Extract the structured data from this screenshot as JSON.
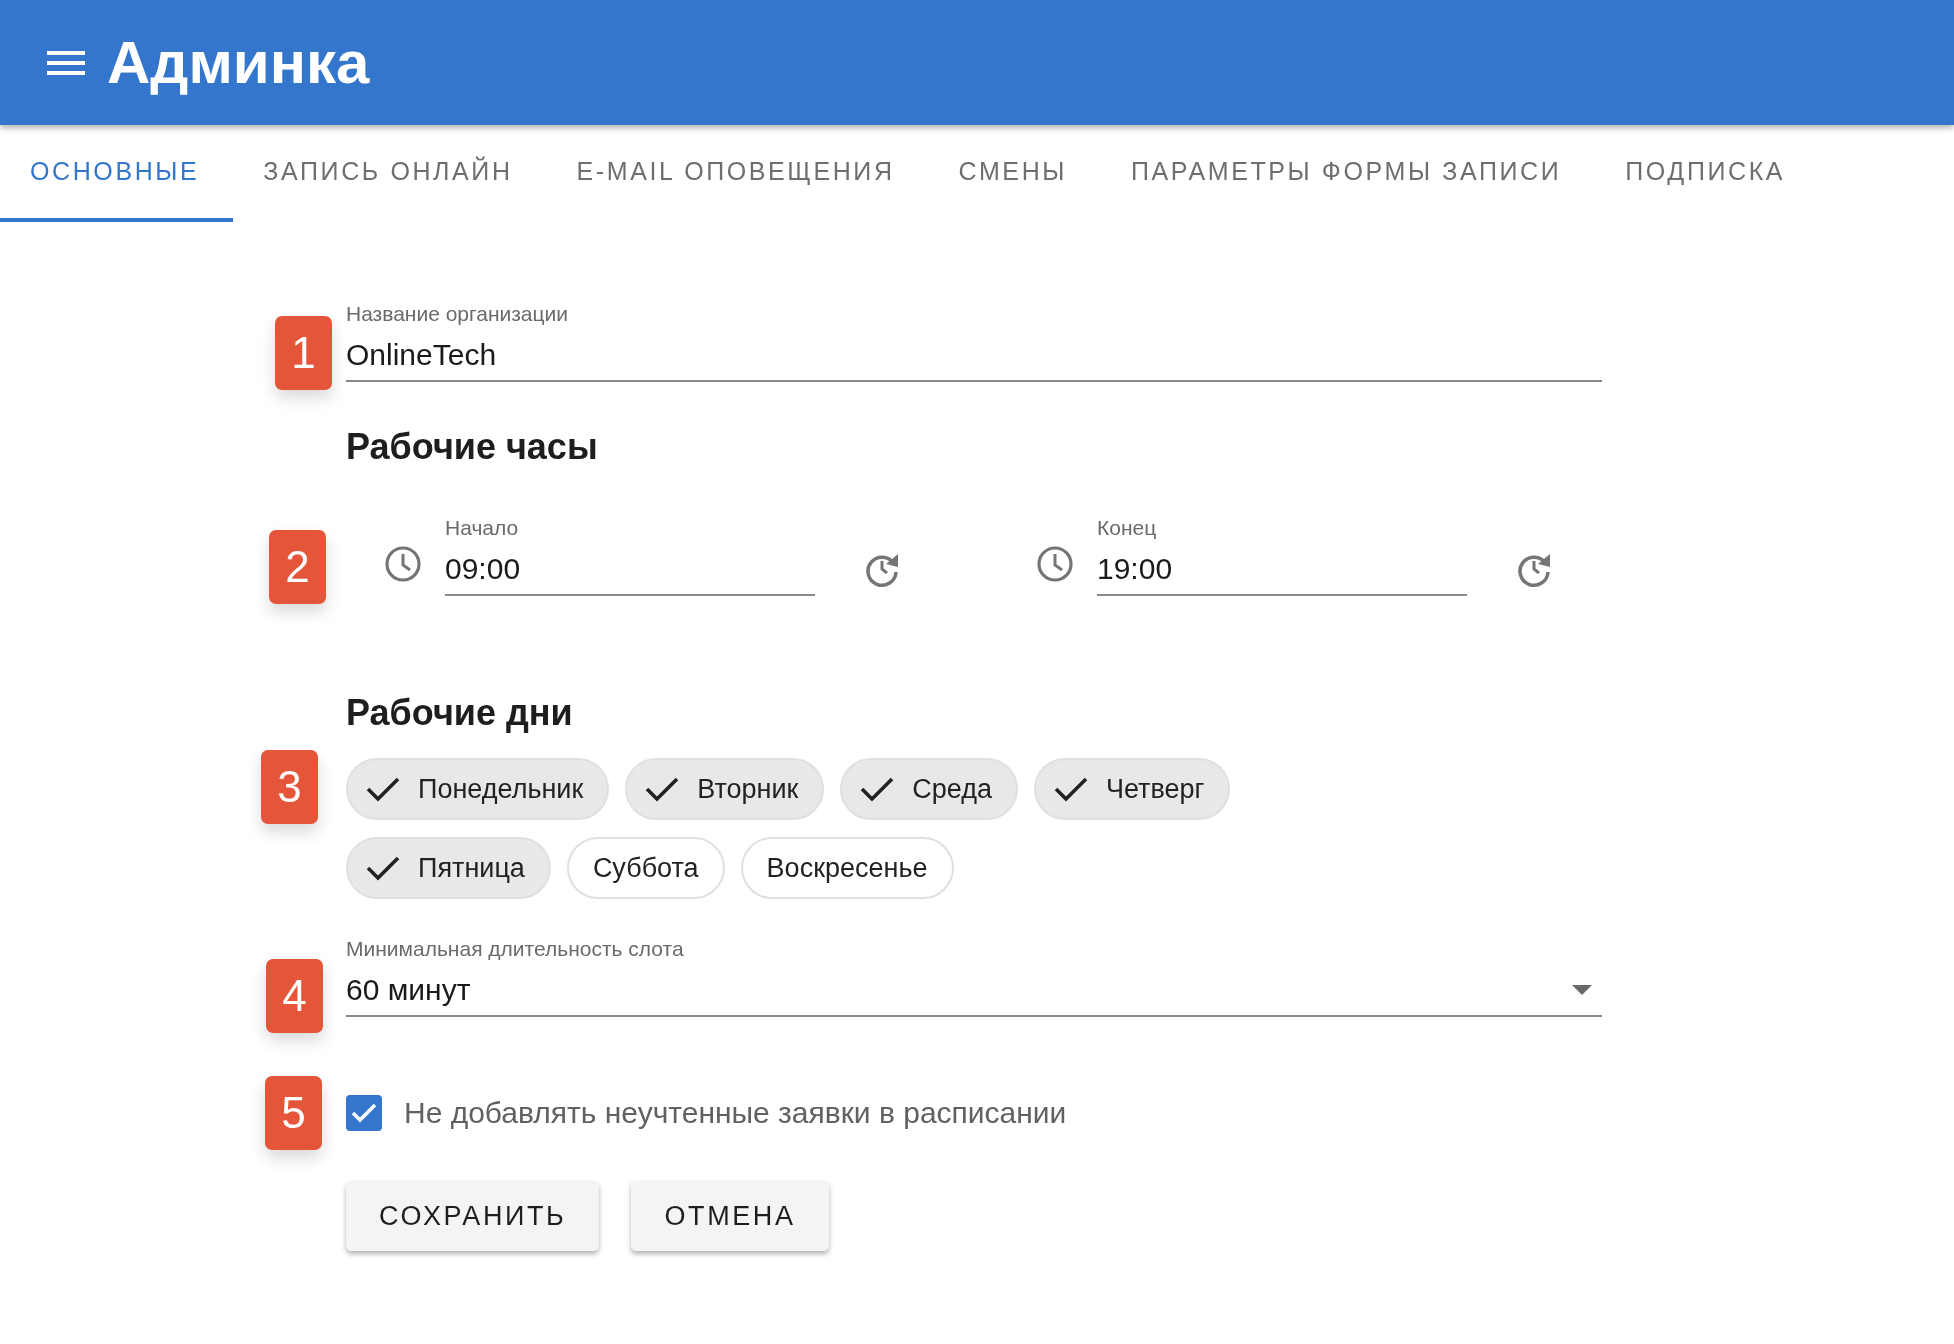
{
  "app_bar": {
    "title": "Админка"
  },
  "tabs": [
    {
      "label": "ОСНОВНЫЕ",
      "selected": true
    },
    {
      "label": "ЗАПИСЬ ОНЛАЙН",
      "selected": false
    },
    {
      "label": "E-MAIL ОПОВЕЩЕНИЯ",
      "selected": false
    },
    {
      "label": "СМЕНЫ",
      "selected": false
    },
    {
      "label": "ПАРАМЕТРЫ ФОРМЫ ЗАПИСИ",
      "selected": false
    },
    {
      "label": "ПОДПИСКА",
      "selected": false
    }
  ],
  "organization_field": {
    "marker": "1",
    "label": "Название организации",
    "value": "OnlineTech"
  },
  "working_hours": {
    "heading": "Рабочие часы",
    "marker": "2",
    "start": {
      "label": "Начало",
      "value": "09:00"
    },
    "end": {
      "label": "Конец",
      "value": "19:00"
    }
  },
  "working_days": {
    "heading": "Рабочие дни",
    "marker": "3",
    "days": [
      {
        "label": "Понедельник",
        "selected": true
      },
      {
        "label": "Вторник",
        "selected": true
      },
      {
        "label": "Среда",
        "selected": true
      },
      {
        "label": "Четверг",
        "selected": true
      },
      {
        "label": "Пятница",
        "selected": true
      },
      {
        "label": "Суббота",
        "selected": false
      },
      {
        "label": "Воскресенье",
        "selected": false
      }
    ]
  },
  "slot_duration": {
    "marker": "4",
    "label": "Минимальная длительность слота",
    "value": "60 минут"
  },
  "exclude_option": {
    "marker": "5",
    "label": "Не добавлять неучтенные заявки в расписании",
    "checked": true
  },
  "buttons": [
    "СОХРАНИТЬ",
    "ОТМЕНА"
  ]
}
